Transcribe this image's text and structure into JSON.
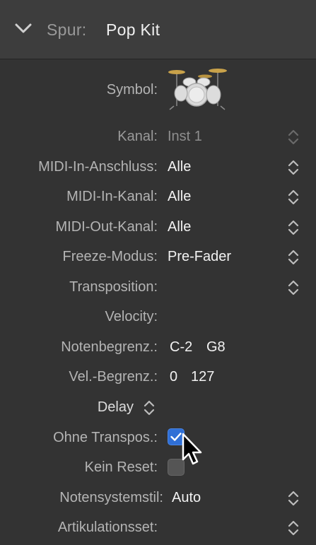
{
  "header": {
    "label": "Spur:",
    "value": "Pop Kit",
    "icon": "chevron-down-icon"
  },
  "rows": {
    "symbol": {
      "label": "Symbol:",
      "icon": "drum-kit-icon"
    },
    "kanal": {
      "label": "Kanal:",
      "value": "Inst 1"
    },
    "midi_in_anschluss": {
      "label": "MIDI-In-Anschluss:",
      "value": "Alle"
    },
    "midi_in_kanal": {
      "label": "MIDI-In-Kanal:",
      "value": "Alle"
    },
    "midi_out_kanal": {
      "label": "MIDI-Out-Kanal:",
      "value": "Alle"
    },
    "freeze_modus": {
      "label": "Freeze-Modus:",
      "value": "Pre-Fader"
    },
    "transposition": {
      "label": "Transposition:",
      "value": ""
    },
    "velocity": {
      "label": "Velocity:",
      "value": ""
    },
    "notenbegrenz": {
      "label": "Notenbegrenz.:",
      "low": "C-2",
      "high": "G8"
    },
    "velbegrenz": {
      "label": "Vel.-Begrenz.:",
      "low": "0",
      "high": "127"
    },
    "delay": {
      "label": "Delay"
    },
    "ohne_transpos": {
      "label": "Ohne Transpos.:",
      "checked": true
    },
    "kein_reset": {
      "label": "Kein Reset:",
      "checked": false
    },
    "notensystemstil": {
      "label": "Notensystemstil:",
      "value": "Auto"
    },
    "artikulationsset": {
      "label": "Artikulationsset:",
      "value": ""
    }
  },
  "colors": {
    "checkbox_on": "#2f6fd6",
    "panel_bg": "#333333",
    "header_bg": "#3d3d3d"
  }
}
